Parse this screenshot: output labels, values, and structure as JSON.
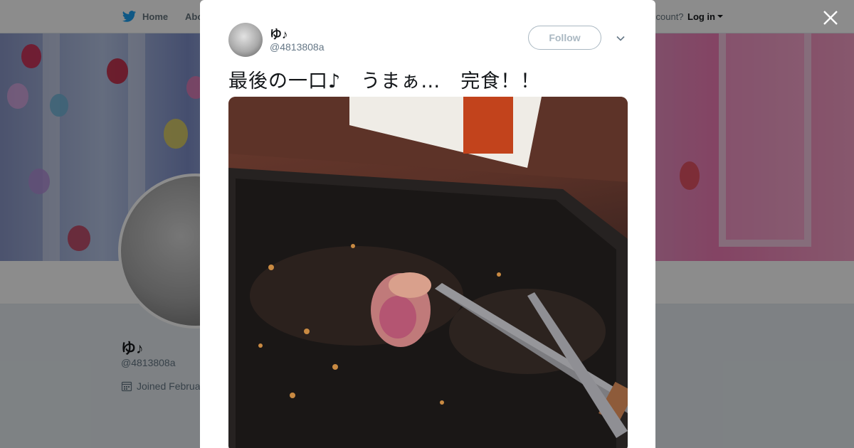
{
  "background_page": {
    "nav": {
      "home_label": "Home",
      "about_label": "Abo",
      "account_text": "ccount?",
      "login_label": "Log in"
    },
    "profile": {
      "name": "ゆ♪",
      "handle": "@4813808a",
      "joined_text": "Joined Februa"
    }
  },
  "modal": {
    "author": {
      "name": "ゆ♪",
      "handle": "@4813808a"
    },
    "follow_label": "Follow",
    "tweet_text": "最後の一口♪　うまぁ…　完食！！",
    "media_description_icon": "photo"
  },
  "colors": {
    "twitter_blue": "#1da1f2",
    "text_primary": "#14171a",
    "text_secondary": "#657786",
    "follow_border": "#aab8c2"
  }
}
